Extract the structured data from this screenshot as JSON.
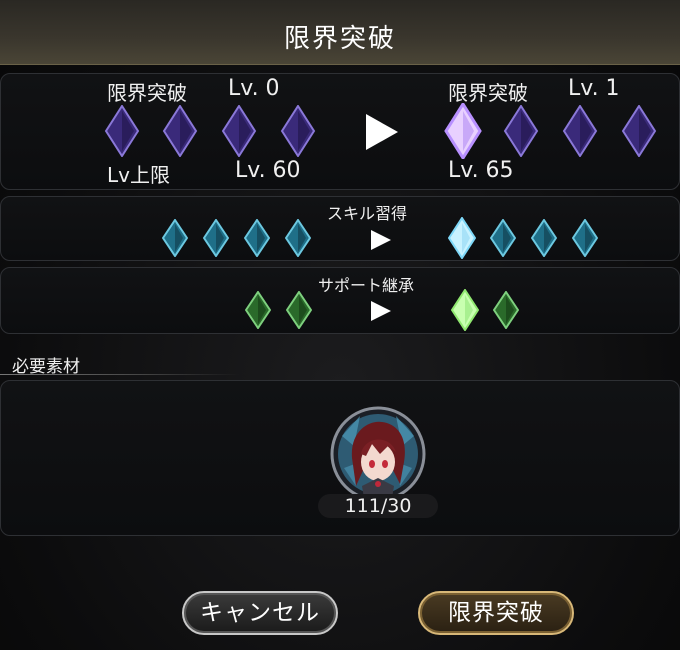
{
  "header": {
    "title": "限界突破"
  },
  "breakthrough": {
    "current_label": "限界突破",
    "current_level": "Lv. 0",
    "next_label": "限界突破",
    "next_level": "Lv. 1",
    "cap_label": "Lv上限",
    "cap_current": "Lv. 60",
    "cap_next": "Lv. 65",
    "current_gems_filled": 0,
    "next_gems_filled": 1,
    "gems_total": 4
  },
  "skill": {
    "label": "スキル習得",
    "current_filled": 0,
    "next_filled": 1,
    "total": 4
  },
  "support": {
    "label": "サポート継承",
    "current_filled": 0,
    "next_filled": 1,
    "total": 2
  },
  "materials": {
    "label": "必要素材",
    "items": [
      {
        "icon": "character-portrait-icon",
        "count": "111/30"
      }
    ]
  },
  "buttons": {
    "cancel": "キャンセル",
    "confirm": "限界突破"
  },
  "colors": {
    "purple_gem": "#3a2a7a",
    "purple_gem_lit": "#e8d0ff",
    "blue_gem": "#1f6f88",
    "blue_gem_lit": "#c8f2ff",
    "green_gem": "#2a6a2a",
    "green_gem_lit": "#c8ffb0",
    "confirm_border": "#d8b878"
  }
}
